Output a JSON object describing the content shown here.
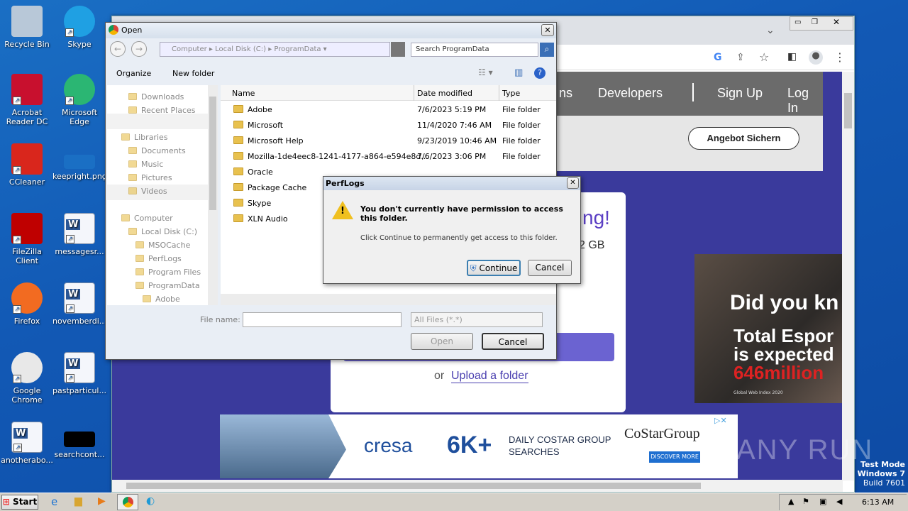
{
  "desktop": {
    "icons": [
      {
        "label": "Recycle Bin",
        "icon": "recycle-bin-icon"
      },
      {
        "label": "Skype",
        "icon": "skype-icon"
      },
      {
        "label": "Acrobat Reader DC",
        "icon": "acrobat-icon"
      },
      {
        "label": "Microsoft Edge",
        "icon": "edge-icon"
      },
      {
        "label": "CCleaner",
        "icon": "ccleaner-icon"
      },
      {
        "label": "keepright.png",
        "icon": "image-file-icon"
      },
      {
        "label": "FileZilla Client",
        "icon": "filezilla-icon"
      },
      {
        "label": "messagesr...",
        "icon": "word-doc-icon"
      },
      {
        "label": "Firefox",
        "icon": "firefox-icon"
      },
      {
        "label": "novemberdi...",
        "icon": "word-doc-icon"
      },
      {
        "label": "Google Chrome",
        "icon": "chrome-icon"
      },
      {
        "label": "pastparticul...",
        "icon": "word-doc-icon"
      },
      {
        "label": "anotherabo...",
        "icon": "word-doc-icon"
      },
      {
        "label": "searchcont...",
        "icon": "black-file-icon"
      }
    ]
  },
  "browser": {
    "nav": {
      "partial": "ns",
      "developers": "Developers",
      "signup": "Sign Up",
      "login": "Log In"
    },
    "angebot": "Angebot Sichern",
    "card": {
      "heading_partial": "ng!",
      "size_partial": "2 GB",
      "or": "or",
      "upload_folder": "Upload a folder"
    },
    "ad": {
      "headline": "Did you kn",
      "line2": "Total Espor",
      "line3": "is expected",
      "line4": "646million",
      "small": "Global Web Index 2020"
    },
    "banner": {
      "brand": "cresa",
      "big": "6K+",
      "daily": "DAILY COSTAR GROUP",
      "searches": "SEARCHES",
      "costar": "CoStarGroup",
      "discover": "DISCOVER MORE"
    }
  },
  "open_dialog": {
    "title": "Open",
    "breadcrumb": [
      "Computer",
      "Local Disk (C:)",
      "ProgramData"
    ],
    "search_placeholder": "Search ProgramData",
    "organize": "Organize",
    "new_folder": "New folder",
    "tree": [
      "Downloads",
      "Recent Places",
      "Libraries",
      "Documents",
      "Music",
      "Pictures",
      "Videos",
      "Computer",
      "Local Disk (C:)",
      "MSOCache",
      "PerfLogs",
      "Program Files",
      "ProgramData",
      "Adobe"
    ],
    "columns": {
      "name": "Name",
      "date": "Date modified",
      "type": "Type"
    },
    "files": [
      {
        "name": "Adobe",
        "date": "7/6/2023 5:19 PM",
        "type": "File folder"
      },
      {
        "name": "Microsoft",
        "date": "11/4/2020 7:46 AM",
        "type": "File folder"
      },
      {
        "name": "Microsoft Help",
        "date": "9/23/2019 10:46 AM",
        "type": "File folder"
      },
      {
        "name": "Mozilla-1de4eec8-1241-4177-a864-e594e8d...",
        "date": "7/6/2023 3:06 PM",
        "type": "File folder"
      },
      {
        "name": "Oracle",
        "date": "",
        "type": ""
      },
      {
        "name": "Package Cache",
        "date": "",
        "type": ""
      },
      {
        "name": "Skype",
        "date": "",
        "type": ""
      },
      {
        "name": "XLN Audio",
        "date": "",
        "type": ""
      }
    ],
    "filename_label": "File name:",
    "filter": "All Files (*.*)",
    "open": "Open",
    "cancel": "Cancel"
  },
  "perm_dialog": {
    "title": "PerfLogs",
    "message": "You don't currently have permission to access this folder.",
    "sub": "Click Continue to permanently get access to this folder.",
    "continue": "Continue",
    "cancel": "Cancel"
  },
  "taskbar": {
    "start": "Start",
    "time": "6:13 AM"
  },
  "watermark": {
    "line1": "Test Mode",
    "line2": "Windows 7",
    "line3": "Build 7601",
    "anyrun": "ANY RUN"
  }
}
